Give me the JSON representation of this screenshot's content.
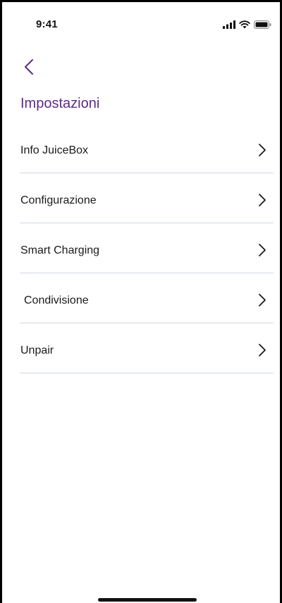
{
  "status_bar": {
    "time": "9:41",
    "icons": [
      "signal-icon",
      "wifi-icon",
      "battery-icon"
    ]
  },
  "header": {
    "back_icon": "chevron-left-icon",
    "title": "Impostazioni"
  },
  "menu": {
    "items": [
      {
        "label": "Info JuiceBox",
        "icon": "chevron-right-icon"
      },
      {
        "label": "Configurazione",
        "icon": "chevron-right-icon"
      },
      {
        "label": "Smart Charging",
        "icon": "chevron-right-icon"
      },
      {
        "label": "Condivisione",
        "icon": "chevron-right-icon"
      },
      {
        "label": "Unpair",
        "icon": "chevron-right-icon"
      }
    ]
  },
  "colors": {
    "accent": "#5b2d82",
    "divider": "#cfd6e3",
    "text": "#1a1a1a",
    "background": "#ffffff"
  }
}
